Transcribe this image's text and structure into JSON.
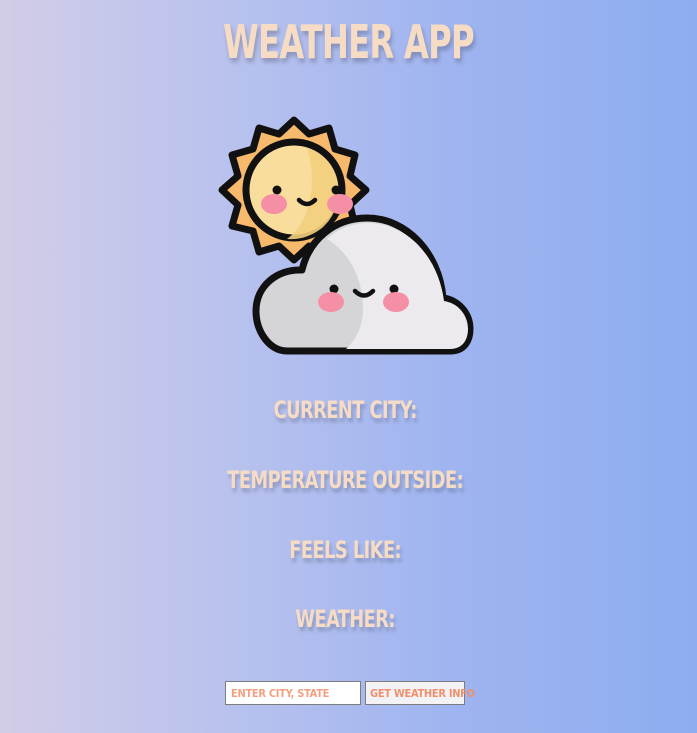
{
  "app": {
    "title": "WEATHER APP"
  },
  "hero": {
    "icon": "sun-cloud-icon",
    "colors": {
      "sun_outer": "#f7b96b",
      "sun_inner": "#f9dd9c",
      "cloud": "#e6e5e9",
      "cloud_shadow": "#d5d5d8",
      "blush": "#f48fa6",
      "stroke": "#111111"
    }
  },
  "details": {
    "current_city_label": "CURRENT CITY:",
    "current_city_value": "",
    "temperature_label": "TEMPERATURE OUTSIDE:",
    "temperature_value": "",
    "feels_like_label": "FEELS LIKE:",
    "feels_like_value": "",
    "weather_label": "WEATHER:",
    "weather_value": ""
  },
  "form": {
    "city_placeholder": "ENTER CITY, STATE",
    "city_value": "",
    "submit_label": "GET WEATHER INFO"
  },
  "theme": {
    "text": "#f6dcc4",
    "accent": "#f08f6c"
  }
}
